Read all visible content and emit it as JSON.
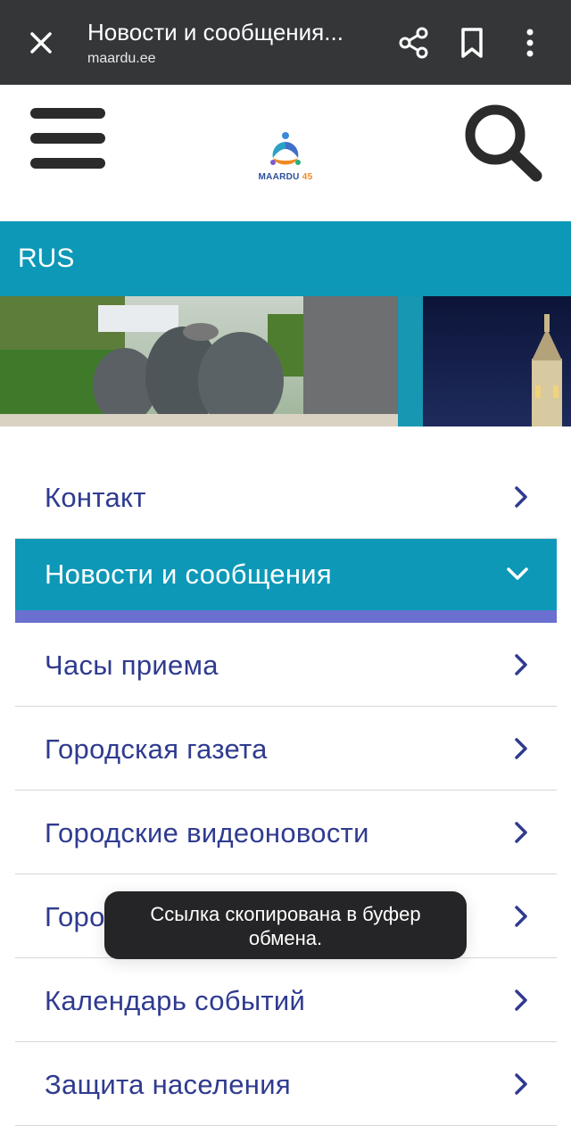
{
  "browser": {
    "title": "Новости и сообщения...",
    "domain": "maardu.ee"
  },
  "site": {
    "logo_text": "MAARDU",
    "logo_number": "45",
    "language": "RUS"
  },
  "menu": {
    "items": [
      {
        "label": "Контакт",
        "state": "collapsed"
      },
      {
        "label": "Новости и сообщения",
        "state": "expanded"
      },
      {
        "label": "Часы приема",
        "state": "collapsed"
      },
      {
        "label": "Городская газета",
        "state": "collapsed"
      },
      {
        "label": "Городские видеоновости",
        "state": "collapsed"
      },
      {
        "label": "Горо",
        "state": "collapsed"
      },
      {
        "label": "Календарь событий",
        "state": "collapsed"
      },
      {
        "label": "Защита населения",
        "state": "collapsed"
      }
    ]
  },
  "toast": {
    "message": "Ссылка скопирована в буфер обмена."
  },
  "colors": {
    "browser_bar": "#343638",
    "accent": "#0d98b7",
    "menu_text": "#2f3b8f",
    "active_underline": "#6a6fd0",
    "toast_bg": "#252527"
  }
}
